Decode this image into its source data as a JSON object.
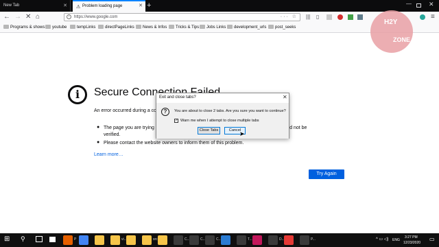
{
  "tabs": [
    {
      "label": "New Tab"
    },
    {
      "label": "Problem loading page"
    }
  ],
  "url": "https://www.google.com",
  "bookmarks": [
    "Programs & shows",
    "youtube",
    "tempLinks",
    "directPageLinks",
    "News & Infos",
    "Tricks & Tips",
    "Jobs Links",
    "development_urls",
    "post_seeks"
  ],
  "error": {
    "title": "Secure Connection Failed",
    "desc": "An error occurred during a co",
    "bullet1_left": "The page you are trying",
    "bullet1_right": "ed data could not be",
    "bullet1_cont": "verified.",
    "bullet2": "Please contact the website owners to inform them of this problem.",
    "learn_more": "Learn more…",
    "try_again": "Try Again"
  },
  "dialog": {
    "title": "Exit and close tabs?",
    "message": "You are about to close 2 tabs. Are you sure you want to continue?",
    "checkbox_label": "Warn me when I attempt to close multiple tabs",
    "checkbox_checked": true,
    "close_tabs": "Close Tabs",
    "cancel": "Cancel"
  },
  "watermark": {
    "line1": "H2Y",
    "line2": "ZONE"
  },
  "taskbar": {
    "apps": [
      {
        "label": "P",
        "color": "#e66000"
      },
      {
        "label": "",
        "color": "#4285f4"
      },
      {
        "label": "",
        "color": "#f6c54a"
      },
      {
        "label": "vi...",
        "color": "#f6c54a"
      },
      {
        "label": "",
        "color": "#f6c54a"
      },
      {
        "label": "src",
        "color": "#f6c54a"
      },
      {
        "label": "",
        "color": "#f6c54a"
      },
      {
        "label": "C...",
        "color": "#3a3a3a"
      },
      {
        "label": "C...",
        "color": "#3a3a3a"
      },
      {
        "label": "C...",
        "color": "#3a3a3a"
      },
      {
        "label": "",
        "color": "#2b7cd3"
      },
      {
        "label": "T...",
        "color": "#3a3a3a"
      },
      {
        "label": "",
        "color": "#c2185b"
      },
      {
        "label": "D...",
        "color": "#3a3a3a"
      },
      {
        "label": "",
        "color": "#e53935"
      },
      {
        "label": "P...",
        "color": "#3a3a3a"
      }
    ],
    "lang": "ENG",
    "time": "3:27 PM",
    "date": "12/23/2020"
  },
  "colors": {
    "accent": "#0060df",
    "tabbar": "#0c0c0d",
    "dialog_focus": "#0078d7"
  }
}
